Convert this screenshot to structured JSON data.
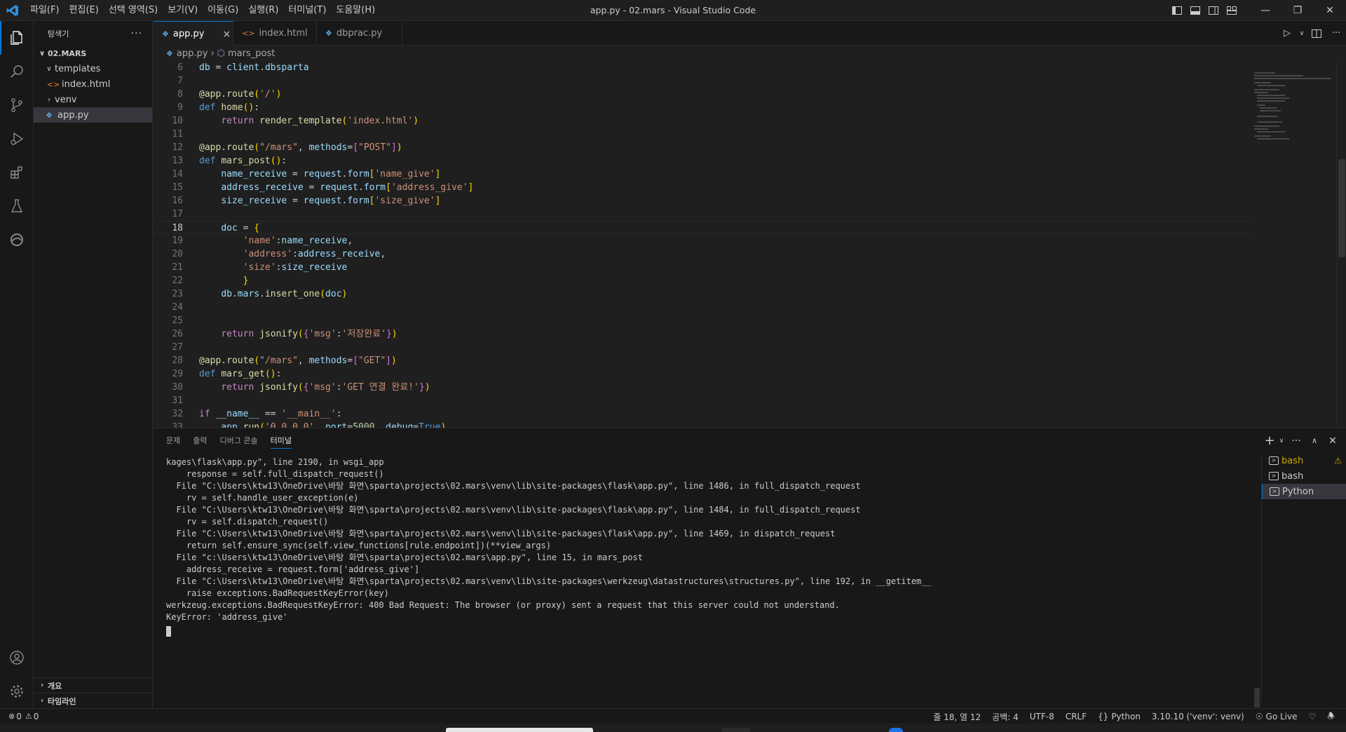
{
  "window": {
    "title": "app.py - 02.mars - Visual Studio Code",
    "menu": [
      "파일(F)",
      "편집(E)",
      "선택 영역(S)",
      "보기(V)",
      "이동(G)",
      "실행(R)",
      "터미널(T)",
      "도움말(H)"
    ]
  },
  "sidebar": {
    "header": "탐색기",
    "more": "···",
    "root": "02.MARS",
    "items": [
      {
        "label": "templates",
        "type": "folder-open"
      },
      {
        "label": "index.html",
        "type": "html"
      },
      {
        "label": "venv",
        "type": "folder"
      },
      {
        "label": "app.py",
        "type": "python"
      }
    ],
    "sections": [
      "개요",
      "타임라인"
    ]
  },
  "tabs": [
    {
      "label": "app.py",
      "close": "×"
    },
    {
      "label": "index.html"
    },
    {
      "label": "dbprac.py"
    }
  ],
  "breadcrumb": {
    "file": "app.py",
    "symbol": "mars_post"
  },
  "code": {
    "line_numbers": [
      "6",
      "7",
      "8",
      "9",
      "10",
      "11",
      "12",
      "13",
      "14",
      "15",
      "16",
      "17",
      "18",
      "19",
      "20",
      "21",
      "22",
      "23",
      "24",
      "25",
      "26",
      "27",
      "28",
      "29",
      "30",
      "31",
      "32",
      "33"
    ],
    "current_line": "18"
  },
  "panel": {
    "tabs": [
      "문제",
      "출력",
      "디버그 콘솔",
      "터미널"
    ],
    "terminal_lines": [
      "kages\\flask\\app.py\", line 2190, in wsgi_app",
      "    response = self.full_dispatch_request()",
      "  File \"C:\\Users\\ktw13\\OneDrive\\바탕 화면\\sparta\\projects\\02.mars\\venv\\lib\\site-packages\\flask\\app.py\", line 1486, in full_dispatch_request",
      "    rv = self.handle_user_exception(e)",
      "  File \"C:\\Users\\ktw13\\OneDrive\\바탕 화면\\sparta\\projects\\02.mars\\venv\\lib\\site-packages\\flask\\app.py\", line 1484, in full_dispatch_request",
      "    rv = self.dispatch_request()",
      "  File \"C:\\Users\\ktw13\\OneDrive\\바탕 화면\\sparta\\projects\\02.mars\\venv\\lib\\site-packages\\flask\\app.py\", line 1469, in dispatch_request",
      "    return self.ensure_sync(self.view_functions[rule.endpoint])(**view_args)",
      "  File \"c:\\Users\\ktw13\\OneDrive\\바탕 화면\\sparta\\projects\\02.mars\\app.py\", line 15, in mars_post",
      "    address_receive = request.form['address_give']",
      "  File \"C:\\Users\\ktw13\\OneDrive\\바탕 화면\\sparta\\projects\\02.mars\\venv\\lib\\site-packages\\werkzeug\\datastructures\\structures.py\", line 192, in __getitem__",
      "    raise exceptions.BadRequestKeyError(key)",
      "werkzeug.exceptions.BadRequestKeyError: 400 Bad Request: The browser (or proxy) sent a request that this server could not understand.",
      "KeyError: 'address_give'"
    ],
    "terminals": [
      "bash",
      "bash",
      "Python"
    ]
  },
  "status": {
    "errors": "0",
    "warnings": "0",
    "position": "줄 18, 열 12",
    "spaces": "공백: 4",
    "encoding": "UTF-8",
    "eol": "CRLF",
    "language": "Python",
    "interpreter": "3.10.10 ('venv': venv)",
    "golive": "Go Live"
  },
  "colors": {
    "accent": "#0078d4",
    "warning": "#cca700"
  }
}
